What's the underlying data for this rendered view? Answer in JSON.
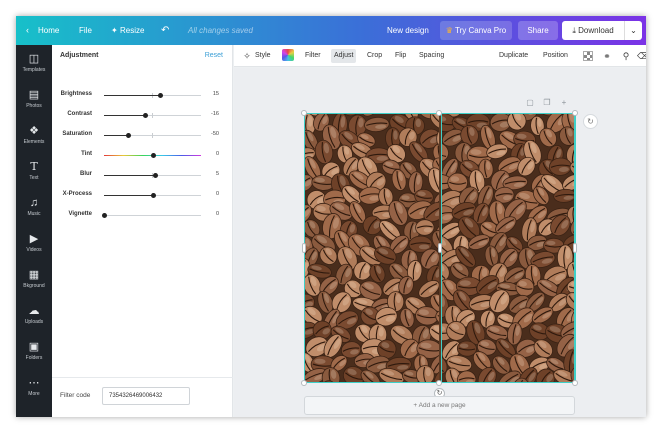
{
  "topbar": {
    "home_label": "Home",
    "file_label": "File",
    "resize_label": "Resize",
    "undo_icon": "undo-icon",
    "save_status": "All changes saved",
    "new_design_label": "New design",
    "try_pro_label": "Try Canva Pro",
    "share_label": "Share",
    "download_label": "Download"
  },
  "sidebar": {
    "items": [
      {
        "label": "Templates",
        "icon": "templates-icon"
      },
      {
        "label": "Photos",
        "icon": "photos-icon"
      },
      {
        "label": "Elements",
        "icon": "elements-icon"
      },
      {
        "label": "Text",
        "icon": "text-icon"
      },
      {
        "label": "Music",
        "icon": "music-icon"
      },
      {
        "label": "Videos",
        "icon": "videos-icon"
      },
      {
        "label": "Bkground",
        "icon": "background-icon"
      },
      {
        "label": "Uploads",
        "icon": "uploads-icon"
      },
      {
        "label": "Folders",
        "icon": "folders-icon"
      },
      {
        "label": "More",
        "icon": "more-icon"
      }
    ]
  },
  "adjustment": {
    "title": "Adjustment",
    "reset_label": "Reset",
    "sliders": [
      {
        "label": "Brightness",
        "value": "15",
        "min": -100,
        "max": 100,
        "num": 15
      },
      {
        "label": "Contrast",
        "value": "-16",
        "min": -100,
        "max": 100,
        "num": -16
      },
      {
        "label": "Saturation",
        "value": "-50",
        "min": -100,
        "max": 100,
        "num": -50
      },
      {
        "label": "Tint",
        "value": "0",
        "min": -100,
        "max": 100,
        "num": 0
      },
      {
        "label": "Blur",
        "value": "5",
        "min": -100,
        "max": 100,
        "num": 5
      },
      {
        "label": "X-Process",
        "value": "0",
        "min": -100,
        "max": 100,
        "num": 0
      },
      {
        "label": "Vignette",
        "value": "0",
        "min": 0,
        "max": 100,
        "num": 0
      }
    ],
    "filter_code_label": "Filter code",
    "filter_code_value": "7354326469006432"
  },
  "toolbar": {
    "style_label": "Style",
    "filter_label": "Filter",
    "adjust_label": "Adjust",
    "crop_label": "Crop",
    "flip_label": "Flip",
    "spacing_label": "Spacing",
    "duplicate_label": "Duplicate",
    "position_label": "Position"
  },
  "canvas": {
    "add_page_label": "+ Add a new page",
    "selection_color": "#3fd0c8"
  },
  "colors": {
    "accent": "#3b9fd6",
    "topbar_start": "#17c0c9",
    "topbar_end": "#7b32e6",
    "rail": "#1e2329"
  }
}
